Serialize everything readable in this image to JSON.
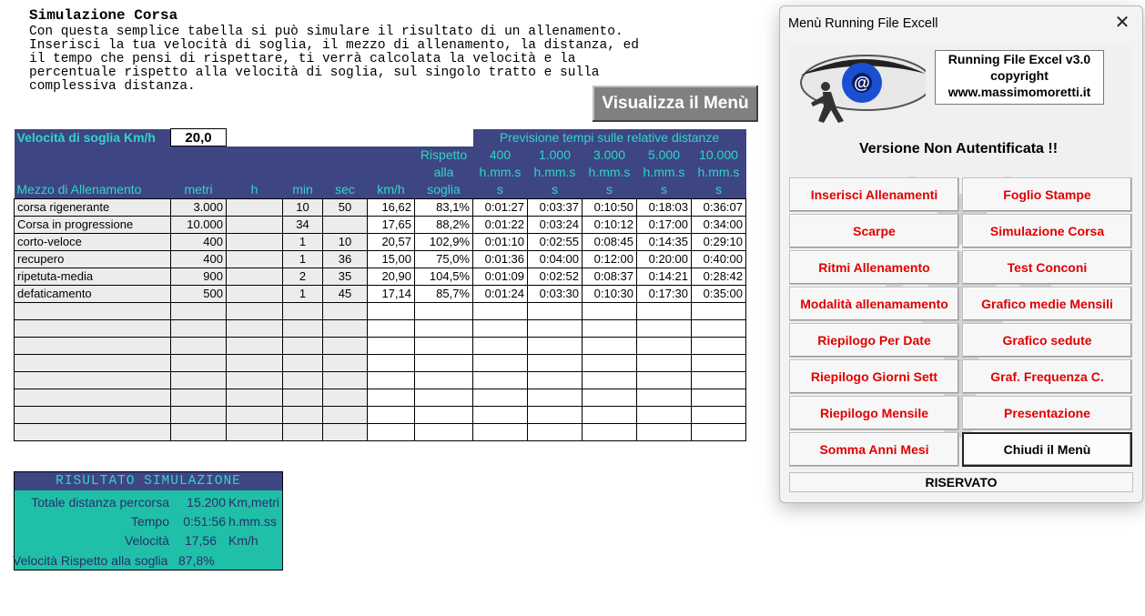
{
  "sheet": {
    "title": "Simulazione Corsa",
    "intro": "Con questa semplice tabella si può simulare il risultato di un allenamento.\nInserisci la tua velocità di soglia, il mezzo di allenamento, la distanza, ed\nil tempo che pensi di rispettare, ti verrà calcolata la velocità e la\npercentuale rispetto alla velocità di soglia, sul singolo tratto e sulla\ncomplessiva distanza.",
    "menu_button": "Visualizza il Menù"
  },
  "threshold": {
    "label": "Velocità di soglia Km/h",
    "value": "20,0"
  },
  "table": {
    "forecast_header": "Previsione tempi sulle relative distanze",
    "col_mezzo": "Mezzo di Allenamento",
    "col_metri": "metri",
    "col_h": "h",
    "col_min": "min",
    "col_sec": "sec",
    "col_kmh": "km/h",
    "col_rispetto_1": "Rispetto",
    "col_rispetto_2": "alla",
    "col_rispetto_3": "soglia",
    "distances": [
      "400",
      "1.000",
      "3.000",
      "5.000",
      "10.000"
    ],
    "hmm_1": "h.mm.s",
    "hmm_2": "s",
    "rows": [
      {
        "mezzo": "corsa rigenerante",
        "metri": "3.000",
        "h": "",
        "min": "10",
        "sec": "50",
        "kmh": "16,62",
        "pct": "83,1%",
        "t": [
          "0:01:27",
          "0:03:37",
          "0:10:50",
          "0:18:03",
          "0:36:07"
        ]
      },
      {
        "mezzo": "Corsa in progressione",
        "metri": "10.000",
        "h": "",
        "min": "34",
        "sec": "",
        "kmh": "17,65",
        "pct": "88,2%",
        "t": [
          "0:01:22",
          "0:03:24",
          "0:10:12",
          "0:17:00",
          "0:34:00"
        ]
      },
      {
        "mezzo": "corto-veloce",
        "metri": "400",
        "h": "",
        "min": "1",
        "sec": "10",
        "kmh": "20,57",
        "pct": "102,9%",
        "t": [
          "0:01:10",
          "0:02:55",
          "0:08:45",
          "0:14:35",
          "0:29:10"
        ]
      },
      {
        "mezzo": "recupero",
        "metri": "400",
        "h": "",
        "min": "1",
        "sec": "36",
        "kmh": "15,00",
        "pct": "75,0%",
        "t": [
          "0:01:36",
          "0:04:00",
          "0:12:00",
          "0:20:00",
          "0:40:00"
        ]
      },
      {
        "mezzo": "ripetuta-media",
        "metri": "900",
        "h": "",
        "min": "2",
        "sec": "35",
        "kmh": "20,90",
        "pct": "104,5%",
        "t": [
          "0:01:09",
          "0:02:52",
          "0:08:37",
          "0:14:21",
          "0:28:42"
        ]
      },
      {
        "mezzo": "defaticamento",
        "metri": "500",
        "h": "",
        "min": "1",
        "sec": "45",
        "kmh": "17,14",
        "pct": "85,7%",
        "t": [
          "0:01:24",
          "0:03:30",
          "0:10:30",
          "0:17:30",
          "0:35:00"
        ]
      }
    ],
    "empty_rows": 8
  },
  "results": {
    "title": "RISULTATO SIMULAZIONE",
    "dist_label": "Totale distanza percorsa",
    "dist_value": "15.200",
    "dist_unit": "Km,metri",
    "tempo_label": "Tempo",
    "tempo_value": "0:51:56",
    "tempo_unit": "h.mm.ss",
    "vel_label": "Velocità",
    "vel_value": "17,56",
    "vel_unit": "Km/h",
    "risp_label": "Velocità Rispetto alla soglia",
    "risp_value": "87,8%"
  },
  "dialog": {
    "title": "Menù Running File Excell",
    "info_line1": "Running File Excel v3.0",
    "info_line2": "copyright",
    "info_line3": "www.massimomoretti.it",
    "auth": "Versione Non Autentificata !!",
    "buttons": [
      "Inserisci Allenamenti",
      "Foglio Stampe",
      "Scarpe",
      "Simulazione Corsa",
      "Ritmi Allenamento",
      "Test Conconi",
      "Modalità allenamamento",
      "Grafico medie Mensili",
      "Riepilogo Per Date",
      "Grafico sedute",
      "Riepilogo Giorni Sett",
      "Graf. Frequenza C.",
      "Riepilogo Mensile",
      "Presentazione",
      "Somma Anni Mesi",
      "Chiudi il Menù"
    ],
    "riservato": "RISERVATO"
  },
  "colors": {
    "header_bg": "#3e4583",
    "header_text": "#30d5c8",
    "result_bg": "#20c0a8",
    "menu_text": "#e00000"
  }
}
